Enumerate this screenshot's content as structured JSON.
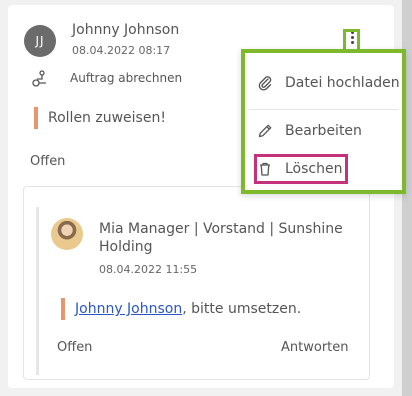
{
  "comment": {
    "avatar_initials": "JJ",
    "author": "Johnny Johnson",
    "date": "08.04.2022 08:17",
    "task_label": "Auftrag abrechnen",
    "quote": "Rollen zuweisen!",
    "status": "Offen"
  },
  "reply": {
    "author": "Mia Manager | Vorstand | Sunshine Holding",
    "date": "08.04.2022 11:55",
    "mention": "Johnny Johnson",
    "text_suffix": ", bitte umsetzen.",
    "status": "Offen",
    "answer_label": "Antworten"
  },
  "menu": {
    "items": [
      {
        "label": "Datei hochladen",
        "icon": "paperclip-icon"
      },
      {
        "label": "Bearbeiten",
        "icon": "pencil-icon"
      },
      {
        "label": "Löschen",
        "icon": "trash-icon"
      }
    ]
  },
  "colors": {
    "highlight_green": "#7dba2b",
    "highlight_pink": "#c4327c",
    "quote_accent": "#e8956b",
    "mention_link": "#2a56c6"
  }
}
